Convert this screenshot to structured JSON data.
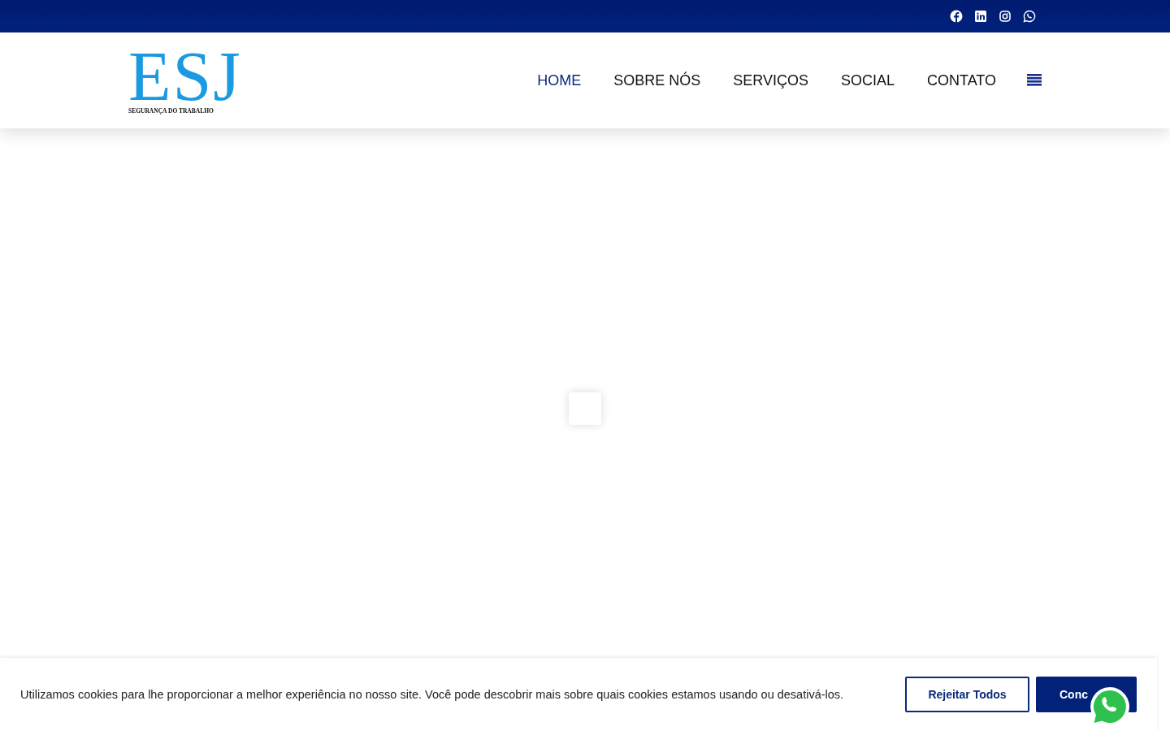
{
  "logo": {
    "letters": "ESJ",
    "tagline": "SEGURANÇA DO TRABALHO"
  },
  "nav": [
    {
      "label": "HOME",
      "selected": true
    },
    {
      "label": "SOBRE NÓS",
      "selected": false
    },
    {
      "label": "SERVIÇOS",
      "selected": false
    },
    {
      "label": "SOCIAL",
      "selected": false
    },
    {
      "label": "CONTATO",
      "selected": false
    }
  ],
  "cookie_banner": {
    "message": "Utilizamos cookies para lhe proporcionar a melhor experiência no nosso site. Você pode descobrir mais sobre quais cookies estamos usando ou desativá-los.",
    "reject": "Rejeitar Todos",
    "accept": "Conc"
  }
}
